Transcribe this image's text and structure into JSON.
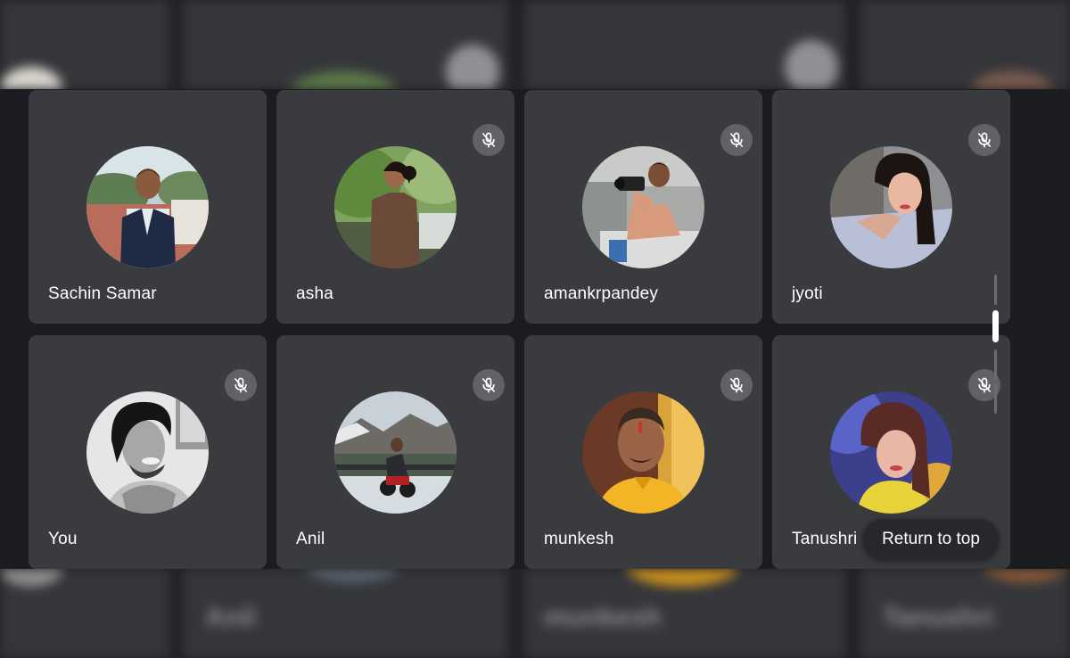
{
  "participants": [
    {
      "name": "Sachin Samar",
      "muted": false
    },
    {
      "name": "asha",
      "muted": true
    },
    {
      "name": "amankrpandey",
      "muted": true
    },
    {
      "name": "jyoti",
      "muted": true
    },
    {
      "name": "You",
      "muted": true
    },
    {
      "name": "Anil",
      "muted": true
    },
    {
      "name": "munkesh",
      "muted": true
    },
    {
      "name": "Tanushri",
      "muted": true
    }
  ],
  "icons": {
    "mute": "mic-off-icon"
  },
  "return_to_top": "Return to top",
  "colors": {
    "tile_background": "#3a3b3f",
    "page_background": "#1b1c1f",
    "mute_badge": "#606266",
    "text": "#ffffff"
  }
}
